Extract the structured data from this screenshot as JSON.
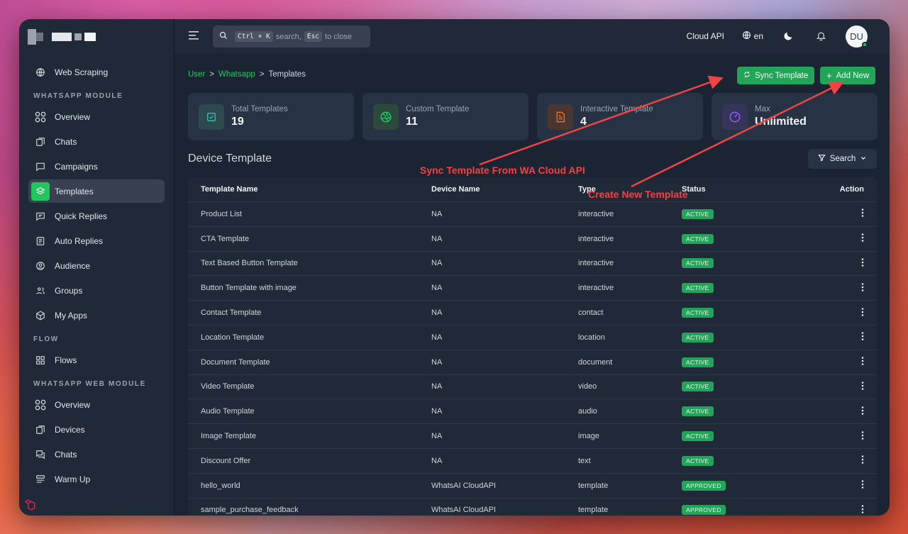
{
  "search": {
    "shortcut": "Ctrl + K",
    "text1": "search,",
    "esc": "Esc",
    "text2": "to close"
  },
  "topbar": {
    "cloud_api": "Cloud API",
    "lang": "en",
    "avatar": "DU"
  },
  "sidebar": {
    "sections": [
      {
        "title": "WEB SCRAPING",
        "items": [
          {
            "label": "Web Scraping",
            "icon": "globe-icon"
          }
        ]
      },
      {
        "title": "WHATSAPP MODULE",
        "items": [
          {
            "label": "Overview",
            "icon": "grid-circles-icon"
          },
          {
            "label": "Chats",
            "icon": "chat-copy-icon"
          },
          {
            "label": "Campaigns",
            "icon": "message-square-icon"
          },
          {
            "label": "Templates",
            "icon": "layers-icon",
            "active": true
          },
          {
            "label": "Quick Replies",
            "icon": "message-reply-icon"
          },
          {
            "label": "Auto Replies",
            "icon": "document-icon"
          },
          {
            "label": "Audience",
            "icon": "user-circle-icon"
          },
          {
            "label": "Groups",
            "icon": "users-icon"
          },
          {
            "label": "My Apps",
            "icon": "cube-icon"
          }
        ]
      },
      {
        "title": "FLOW",
        "items": [
          {
            "label": "Flows",
            "icon": "grid-icon"
          }
        ]
      },
      {
        "title": "WHATSAPP WEB MODULE",
        "items": [
          {
            "label": "Overview",
            "icon": "grid-circles-icon"
          },
          {
            "label": "Devices",
            "icon": "chat-copy-icon"
          },
          {
            "label": "Chats",
            "icon": "chats-icon"
          },
          {
            "label": "Warm Up",
            "icon": "list-icon"
          }
        ]
      }
    ]
  },
  "breadcrumb": {
    "user": "User",
    "whatsapp": "Whatsapp",
    "current": "Templates",
    "sep": ">"
  },
  "buttons": {
    "sync": "Sync Template",
    "add": "Add New"
  },
  "cards": [
    {
      "title": "Total Templates",
      "value": "19",
      "color": "#2dd4bf",
      "bg": "#2d4a4f",
      "icon": "checkbox-icon"
    },
    {
      "title": "Custom Template",
      "value": "11",
      "color": "#22c55e",
      "bg": "#2b4a3c",
      "icon": "aperture-icon"
    },
    {
      "title": "Interactive Template",
      "value": "4",
      "color": "#f97316",
      "bg": "#4a3530",
      "icon": "file-icon"
    },
    {
      "title": "Max",
      "value": "Unlimited",
      "color": "#8b5cf6",
      "bg": "#37345a",
      "icon": "gauge-icon"
    }
  ],
  "section_title": "Device Template",
  "search_button": "Search",
  "table": {
    "headers": [
      "Template Name",
      "Device Name",
      "Type",
      "Status",
      "Action"
    ],
    "rows": [
      [
        "Product List",
        "NA",
        "interactive",
        "ACTIVE"
      ],
      [
        "CTA Template",
        "NA",
        "interactive",
        "ACTIVE"
      ],
      [
        "Text Based Button Template",
        "NA",
        "interactive",
        "ACTIVE"
      ],
      [
        "Button Template with image",
        "NA",
        "interactive",
        "ACTIVE"
      ],
      [
        "Contact Template",
        "NA",
        "contact",
        "ACTIVE"
      ],
      [
        "Location Template",
        "NA",
        "location",
        "ACTIVE"
      ],
      [
        "Document Template",
        "NA",
        "document",
        "ACTIVE"
      ],
      [
        "Video Template",
        "NA",
        "video",
        "ACTIVE"
      ],
      [
        "Audio Template",
        "NA",
        "audio",
        "ACTIVE"
      ],
      [
        "Image Template",
        "NA",
        "image",
        "ACTIVE"
      ],
      [
        "Discount Offer",
        "NA",
        "text",
        "ACTIVE"
      ],
      [
        "hello_world",
        "WhatsAI CloudAPI",
        "template",
        "APPROVED"
      ],
      [
        "sample_purchase_feedback",
        "WhatsAI CloudAPI",
        "template",
        "APPROVED"
      ]
    ]
  },
  "annotations": {
    "sync": "Sync Template From WA Cloud API",
    "create": "Create New Template",
    "color": "#ef4444"
  }
}
